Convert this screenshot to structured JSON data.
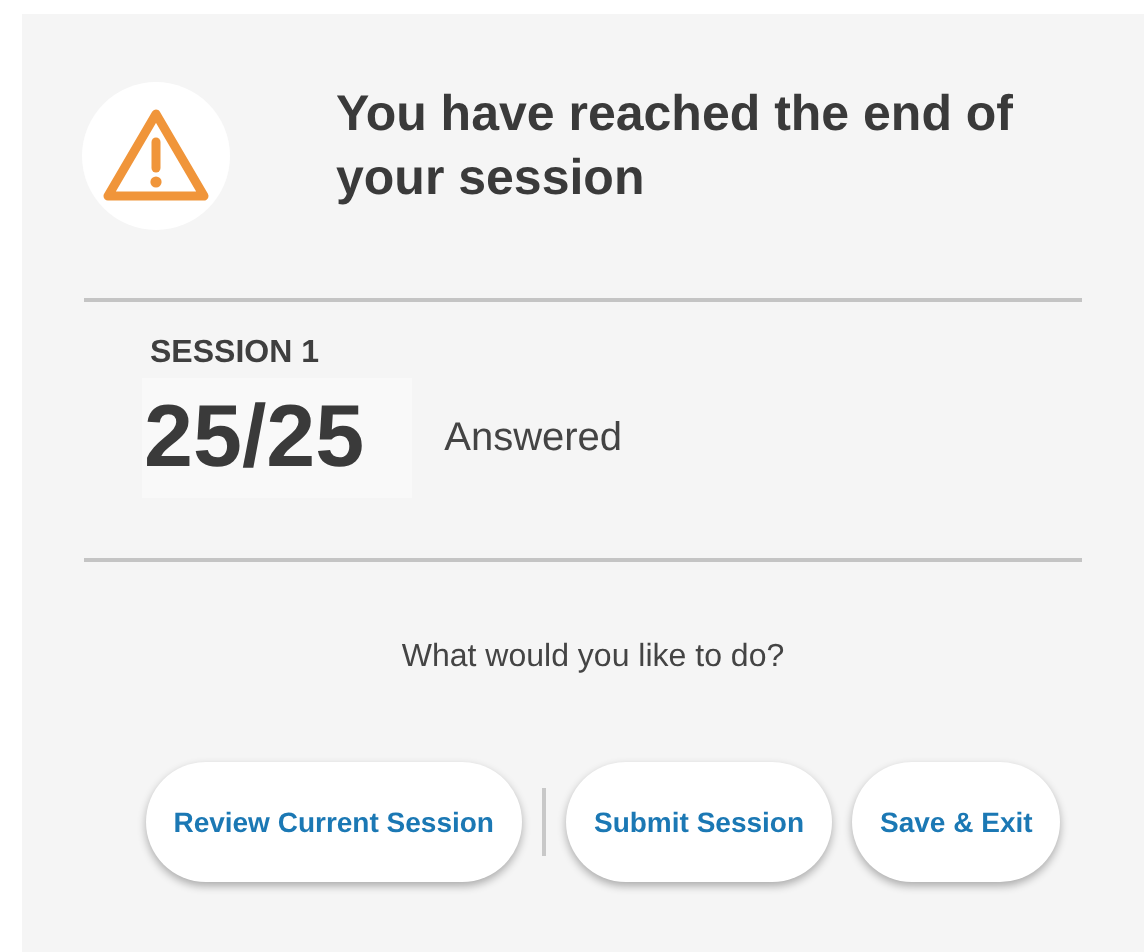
{
  "title": "You have reached the end of your session",
  "session": {
    "label": "SESSION 1",
    "count": "25/25",
    "status": "Answered"
  },
  "prompt": "What would you like to do?",
  "buttons": [
    "Review Current Session",
    "Submit Session",
    "Save & Exit"
  ]
}
